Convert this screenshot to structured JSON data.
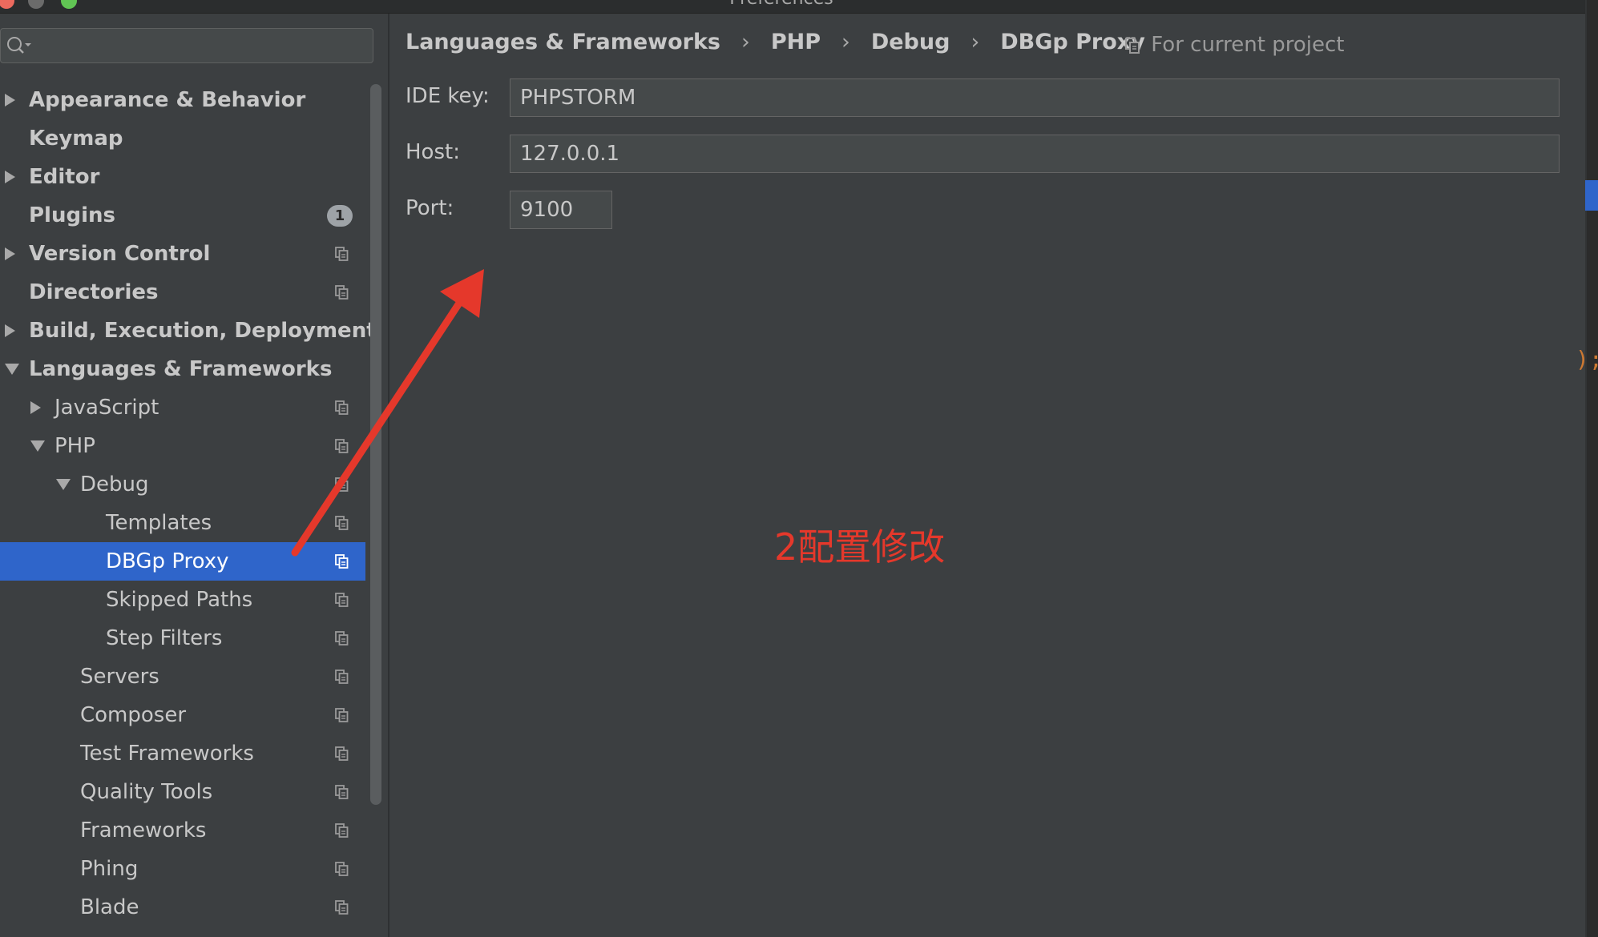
{
  "window": {
    "title": "Preferences"
  },
  "search": {
    "placeholder": ""
  },
  "sidebar": {
    "items": [
      {
        "label": "Appearance & Behavior",
        "indent": 0,
        "arrow": "right",
        "bold": true,
        "scope_icon": false,
        "selected": false
      },
      {
        "label": "Keymap",
        "indent": 0,
        "arrow": "none",
        "bold": true,
        "scope_icon": false,
        "selected": false
      },
      {
        "label": "Editor",
        "indent": 0,
        "arrow": "right",
        "bold": true,
        "scope_icon": false,
        "selected": false
      },
      {
        "label": "Plugins",
        "indent": 0,
        "arrow": "none",
        "bold": true,
        "scope_icon": false,
        "selected": false,
        "badge": "1"
      },
      {
        "label": "Version Control",
        "indent": 0,
        "arrow": "right",
        "bold": true,
        "scope_icon": true,
        "selected": false
      },
      {
        "label": "Directories",
        "indent": 0,
        "arrow": "none",
        "bold": true,
        "scope_icon": true,
        "selected": false
      },
      {
        "label": "Build, Execution, Deployment",
        "indent": 0,
        "arrow": "right",
        "bold": true,
        "scope_icon": false,
        "selected": false
      },
      {
        "label": "Languages & Frameworks",
        "indent": 0,
        "arrow": "down",
        "bold": true,
        "scope_icon": false,
        "selected": false
      },
      {
        "label": "JavaScript",
        "indent": 1,
        "arrow": "right",
        "bold": false,
        "scope_icon": true,
        "selected": false
      },
      {
        "label": "PHP",
        "indent": 1,
        "arrow": "down",
        "bold": false,
        "scope_icon": true,
        "selected": false
      },
      {
        "label": "Debug",
        "indent": 2,
        "arrow": "down",
        "bold": false,
        "scope_icon": true,
        "selected": false
      },
      {
        "label": "Templates",
        "indent": 3,
        "arrow": "none",
        "bold": false,
        "scope_icon": true,
        "selected": false
      },
      {
        "label": "DBGp Proxy",
        "indent": 3,
        "arrow": "none",
        "bold": false,
        "scope_icon": true,
        "selected": true
      },
      {
        "label": "Skipped Paths",
        "indent": 3,
        "arrow": "none",
        "bold": false,
        "scope_icon": true,
        "selected": false
      },
      {
        "label": "Step Filters",
        "indent": 3,
        "arrow": "none",
        "bold": false,
        "scope_icon": true,
        "selected": false
      },
      {
        "label": "Servers",
        "indent": 2,
        "arrow": "none",
        "bold": false,
        "scope_icon": true,
        "selected": false
      },
      {
        "label": "Composer",
        "indent": 2,
        "arrow": "none",
        "bold": false,
        "scope_icon": true,
        "selected": false
      },
      {
        "label": "Test Frameworks",
        "indent": 2,
        "arrow": "none",
        "bold": false,
        "scope_icon": true,
        "selected": false
      },
      {
        "label": "Quality Tools",
        "indent": 2,
        "arrow": "none",
        "bold": false,
        "scope_icon": true,
        "selected": false
      },
      {
        "label": "Frameworks",
        "indent": 2,
        "arrow": "none",
        "bold": false,
        "scope_icon": true,
        "selected": false
      },
      {
        "label": "Phing",
        "indent": 2,
        "arrow": "none",
        "bold": false,
        "scope_icon": true,
        "selected": false
      },
      {
        "label": "Blade",
        "indent": 2,
        "arrow": "none",
        "bold": false,
        "scope_icon": true,
        "selected": false
      }
    ]
  },
  "breadcrumb": {
    "items": [
      "Languages & Frameworks",
      "PHP",
      "Debug",
      "DBGp Proxy"
    ],
    "separator": "›"
  },
  "scope_hint": {
    "label": "For current project"
  },
  "form": {
    "ide_key_label": "IDE key:",
    "ide_key_value": "PHPSTORM",
    "host_label": "Host:",
    "host_value": "127.0.0.1",
    "port_label": "Port:",
    "port_value": "9100"
  },
  "annotation": {
    "text": "2配置修改",
    "color": "#e5382b"
  },
  "colors": {
    "background": "#3c3f41",
    "selection": "#2f65ca",
    "input_background": "#45494a",
    "text": "#c8c8c8"
  }
}
